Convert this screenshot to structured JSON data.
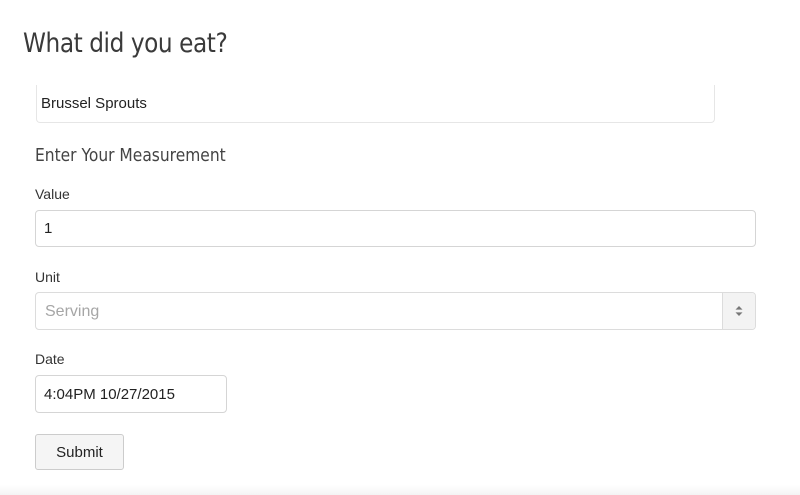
{
  "page": {
    "title": "What did you eat?"
  },
  "food": {
    "selected": "Brussel Sprouts"
  },
  "measurement": {
    "heading": "Enter Your Measurement",
    "value_label": "Value",
    "value": "1",
    "unit_label": "Unit",
    "unit_selected": "Serving",
    "date_label": "Date",
    "date_value": "4:04PM 10/27/2015"
  },
  "form": {
    "submit_label": "Submit"
  }
}
